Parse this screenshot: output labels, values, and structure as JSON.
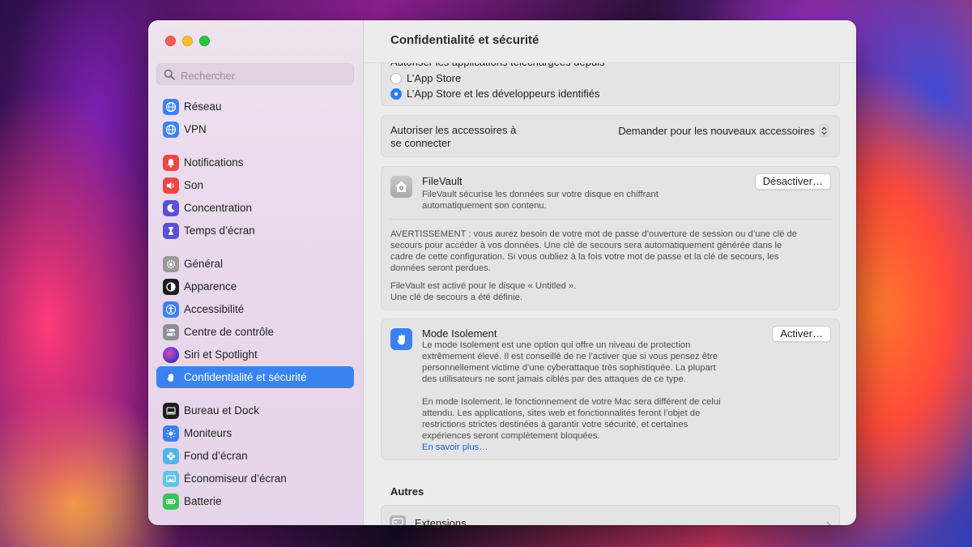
{
  "window": {
    "title": "Confidentialité et sécurité"
  },
  "search": {
    "placeholder": "Rechercher"
  },
  "sidebar": {
    "items": [
      {
        "label": "Réseau",
        "icon": "globe-icon",
        "color": "#3b82f0"
      },
      {
        "label": "VPN",
        "icon": "globe-icon",
        "color": "#3b82f0"
      },
      {
        "label": "Notifications",
        "icon": "bell-icon",
        "color": "#f04545"
      },
      {
        "label": "Son",
        "icon": "speaker-icon",
        "color": "#f04545"
      },
      {
        "label": "Concentration",
        "icon": "moon-icon",
        "color": "#5a52d6"
      },
      {
        "label": "Temps d’écran",
        "icon": "hourglass-icon",
        "color": "#5a52d6"
      },
      {
        "label": "Général",
        "icon": "gear-icon",
        "color": "#9a9a9a"
      },
      {
        "label": "Apparence",
        "icon": "appearance-icon",
        "color": "#1c1c1c"
      },
      {
        "label": "Accessibilité",
        "icon": "accessibility-icon",
        "color": "#3b82f0"
      },
      {
        "label": "Centre de contrôle",
        "icon": "toggles-icon",
        "color": "#8e8e93"
      },
      {
        "label": "Siri et Spotlight",
        "icon": "siri-icon",
        "color": "#3a3a6a"
      },
      {
        "label": "Confidentialité et sécurité",
        "icon": "hand-icon",
        "color": "#3b82f0"
      },
      {
        "label": "Bureau et Dock",
        "icon": "dock-icon",
        "color": "#1c1c1c"
      },
      {
        "label": "Moniteurs",
        "icon": "sun-icon",
        "color": "#3b82f0"
      },
      {
        "label": "Fond d’écran",
        "icon": "flower-icon",
        "color": "#4fb6e8"
      },
      {
        "label": "Économiseur d’écran",
        "icon": "screensaver-icon",
        "color": "#5fc4e8"
      },
      {
        "label": "Batterie",
        "icon": "battery-icon",
        "color": "#3cc25a"
      }
    ],
    "active_index": 11
  },
  "downloads": {
    "heading_partial": "Autoriser les applications téléchargées depuis",
    "options": [
      "L’App Store",
      "L’App Store et les développeurs identifiés"
    ],
    "selected_index": 1
  },
  "accessories": {
    "label": "Autoriser les accessoires à se connecter",
    "label_line1": "Autoriser les accessoires à",
    "label_line2": "se connecter",
    "value": "Demander pour les nouveaux accessoires"
  },
  "filevault": {
    "title": "FileVault",
    "description_line1": "FileVault sécurise les données sur votre disque en chiffrant",
    "description_line2": "automatiquement son contenu.",
    "button": "Désactiver…",
    "warning_lines": [
      "AVERTISSEMENT : vous aurez besoin de votre mot de passe d’ouverture de session ou d’une clé de",
      "secours pour accéder à vos données. Une clé de secours sera automatiquement générée dans le",
      "cadre de cette configuration. Si vous oubliez à la fois votre mot de passe et la clé de secours, les",
      "données seront perdues."
    ],
    "status_lines": [
      "FileVault est activé pour le disque « Untitled ».",
      "Une clé de secours a été définie."
    ]
  },
  "lockdown": {
    "title": "Mode Isolement",
    "button": "Activer…",
    "paragraph1_lines": [
      "Le mode Isolement est une option qui offre un niveau de protection",
      "extrêmement élevé. Il est conseillé de ne l’activer que si vous pensez être",
      "personnellement victime d’une cyberattaque très sophistiquée. La plupart",
      "des utilisateurs ne sont jamais ciblés par des attaques de ce type."
    ],
    "paragraph2_lines": [
      "En mode Isolement, le fonctionnement de votre Mac sera différent de celui",
      "attendu. Les applications, sites web et fonctionnalités feront l’objet de",
      "restrictions strictes destinées à garantir votre sécurité, et certaines",
      "expériences seront complètement bloquées."
    ],
    "link": "En savoir plus…"
  },
  "others": {
    "heading": "Autres",
    "items": [
      {
        "label": "Extensions",
        "icon": "extensions-icon"
      }
    ]
  },
  "colors": {
    "accent": "#3a84f2",
    "link": "#1a64d6"
  }
}
